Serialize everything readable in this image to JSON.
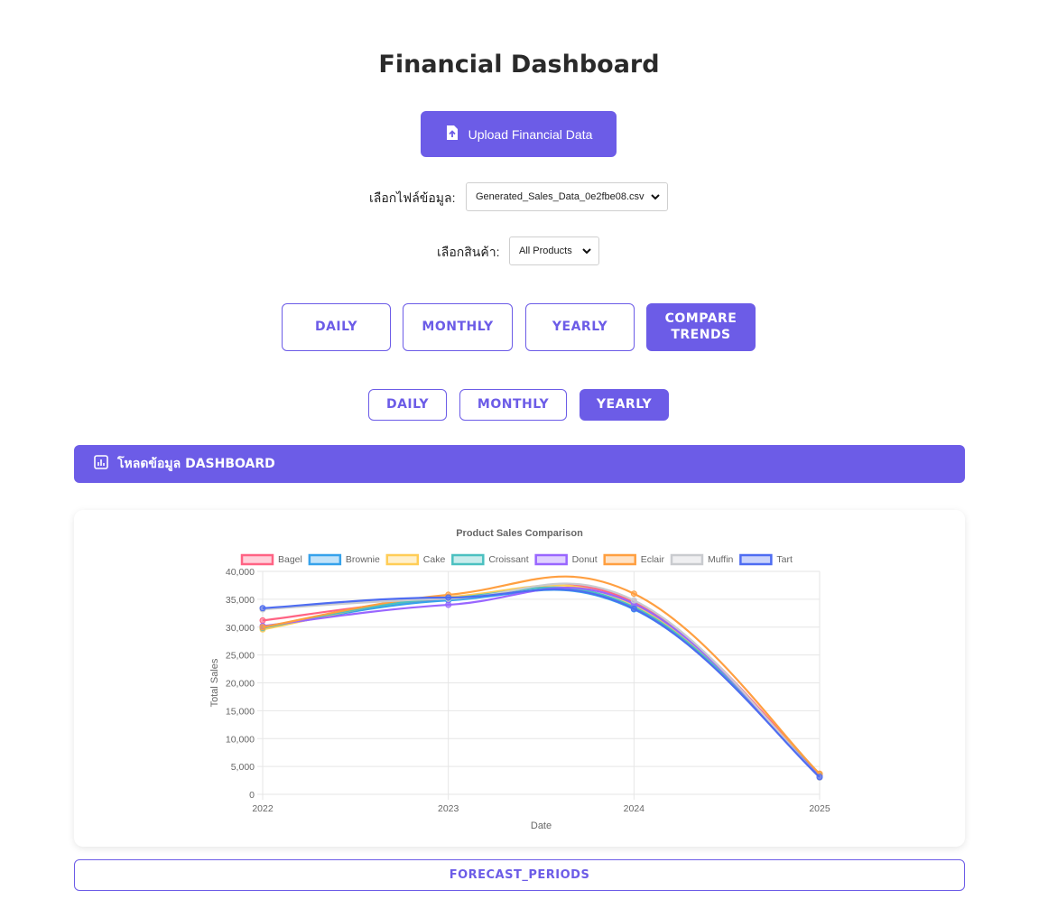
{
  "header": {
    "title": "Financial Dashboard"
  },
  "upload": {
    "label": "Upload Financial Data",
    "icon": "file-upload-icon"
  },
  "file_select": {
    "label": "เลือกไฟล์ข้อมูล:",
    "value": "Generated_Sales_Data_0e2fbe08.csv"
  },
  "product_select": {
    "label": "เลือกสินค้า:",
    "value": "All Products"
  },
  "view_tabs": [
    {
      "label": "DAILY",
      "active": false
    },
    {
      "label": "MONTHLY",
      "active": false
    },
    {
      "label": "YEARLY",
      "active": false
    },
    {
      "label": "COMPARE TRENDS",
      "active": true
    }
  ],
  "period_tabs": [
    {
      "label": "DAILY",
      "active": false
    },
    {
      "label": "MONTHLY",
      "active": false
    },
    {
      "label": "YEARLY",
      "active": true
    }
  ],
  "dashboard_bar": {
    "label": "โหลดข้อมูล DASHBOARD",
    "icon": "chart-icon"
  },
  "forecast": {
    "label": "FORECAST_PERIODS"
  },
  "colors": {
    "accent": "#6c5ce7"
  },
  "chart_data": {
    "type": "line",
    "title": "Product Sales Comparison",
    "xlabel": "Date",
    "ylabel": "Total Sales",
    "categories": [
      "2022",
      "2023",
      "2024",
      "2025"
    ],
    "ylim": [
      0,
      40000
    ],
    "yticks": [
      "0",
      "5,000",
      "10,000",
      "15,000",
      "20,000",
      "25,000",
      "30,000",
      "35,000",
      "40,000"
    ],
    "grid": true,
    "legend": "top",
    "series": [
      {
        "name": "Bagel",
        "color": "#ff6384",
        "values": [
          31200,
          35000,
          34500,
          3600
        ]
      },
      {
        "name": "Brownie",
        "color": "#36a2eb",
        "values": [
          29800,
          34800,
          33200,
          3300
        ]
      },
      {
        "name": "Cake",
        "color": "#ffcd56",
        "values": [
          29600,
          35400,
          34000,
          3500
        ]
      },
      {
        "name": "Croissant",
        "color": "#4bc0c0",
        "values": [
          29900,
          35200,
          33600,
          3400
        ]
      },
      {
        "name": "Donut",
        "color": "#9966ff",
        "values": [
          30200,
          34000,
          34200,
          3200
        ]
      },
      {
        "name": "Eclair",
        "color": "#ff9f40",
        "values": [
          30000,
          35800,
          36000,
          3700
        ]
      },
      {
        "name": "Muffin",
        "color": "#c9cbcf",
        "values": [
          33200,
          35100,
          34800,
          3000
        ]
      },
      {
        "name": "Tart",
        "color": "#4e6cf2",
        "values": [
          33400,
          35300,
          33300,
          3100
        ]
      }
    ]
  }
}
